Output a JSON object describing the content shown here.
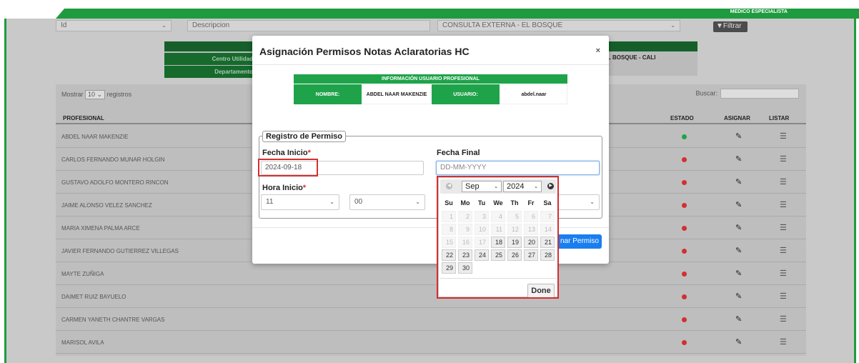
{
  "topbar": {
    "role": "MEDICO ESPECIALISTA"
  },
  "filters": {
    "field": "Id",
    "description_placeholder": "Descripcion",
    "site": "CONSULTA EXTERNA - EL BOSQUE",
    "filter_button": "Filtrar"
  },
  "info": {
    "labels": [
      "Centro Utilidad",
      "Departamento"
    ],
    "site_suffix": "L BOSQUE - CALI"
  },
  "table": {
    "show_prefix": "Mostrar",
    "show_value": "10",
    "show_suffix": "registros",
    "search_label": "Buscar:",
    "headers": {
      "professional": "PROFESIONAL",
      "status": "ESTADO",
      "assign": "ASIGNAR",
      "list": "LISTAR"
    },
    "rows": [
      {
        "name": "ABDEL NAAR MAKENZIE",
        "status_color": "#1fa34a"
      },
      {
        "name": "CARLOS FERNANDO MUNAR HOLGIN",
        "status_color": "#d32f2f"
      },
      {
        "name": "GUSTAVO ADOLFO MONTERO RINCON",
        "status_color": "#d32f2f"
      },
      {
        "name": "JAIME ALONSO VELEZ SANCHEZ",
        "status_color": "#d32f2f"
      },
      {
        "name": "MARIA XIMENA PALMA ARCE",
        "status_color": "#d32f2f"
      },
      {
        "name": "JAVIER FERNANDO GUTIERREZ VILLEGAS",
        "status_color": "#d32f2f"
      },
      {
        "name": "MAYTE ZUÑIGA",
        "status_color": "#d32f2f"
      },
      {
        "name": "DAIMET RUIZ BAYUELO",
        "status_color": "#d32f2f"
      },
      {
        "name": "CARMEN YANETH CHANTRE VARGAS",
        "status_color": "#d32f2f"
      },
      {
        "name": "MARISOL AVILA",
        "status_color": "#d32f2f"
      }
    ]
  },
  "modal": {
    "title": "Asignación Permisos Notas Aclaratorias HC",
    "close": "×",
    "user_info": {
      "header": "INFORMACIÓN USUARIO PROFESIONAL",
      "name_label": "NOMBRE:",
      "name_value": "ABDEL NAAR MAKENZIE",
      "user_label": "USUARIO:",
      "user_value": "abdel.naar"
    },
    "legend": "Registro de Permiso",
    "start_date_label": "Fecha Inicio",
    "start_date_value": "2024-09-18",
    "end_date_label": "Fecha Final",
    "end_date_placeholder": "DD-MM-YYYY",
    "start_time_label": "Hora Inicio",
    "hour_value": "11",
    "minute_value": "00",
    "required_mark": "*",
    "assign_button": "nar Permiso"
  },
  "datepicker": {
    "month": "Sep",
    "year": "2024",
    "weekdays": [
      "Su",
      "Mo",
      "Tu",
      "We",
      "Th",
      "Fr",
      "Sa"
    ],
    "disabled_days": [
      "1",
      "2",
      "3",
      "4",
      "5",
      "6",
      "7",
      "8",
      "9",
      "10",
      "11",
      "12",
      "13",
      "14",
      "15",
      "16",
      "17"
    ],
    "enabled_days": [
      "18",
      "19",
      "20",
      "21",
      "22",
      "23",
      "24",
      "25",
      "26",
      "27",
      "28",
      "29",
      "30"
    ],
    "done": "Done"
  }
}
